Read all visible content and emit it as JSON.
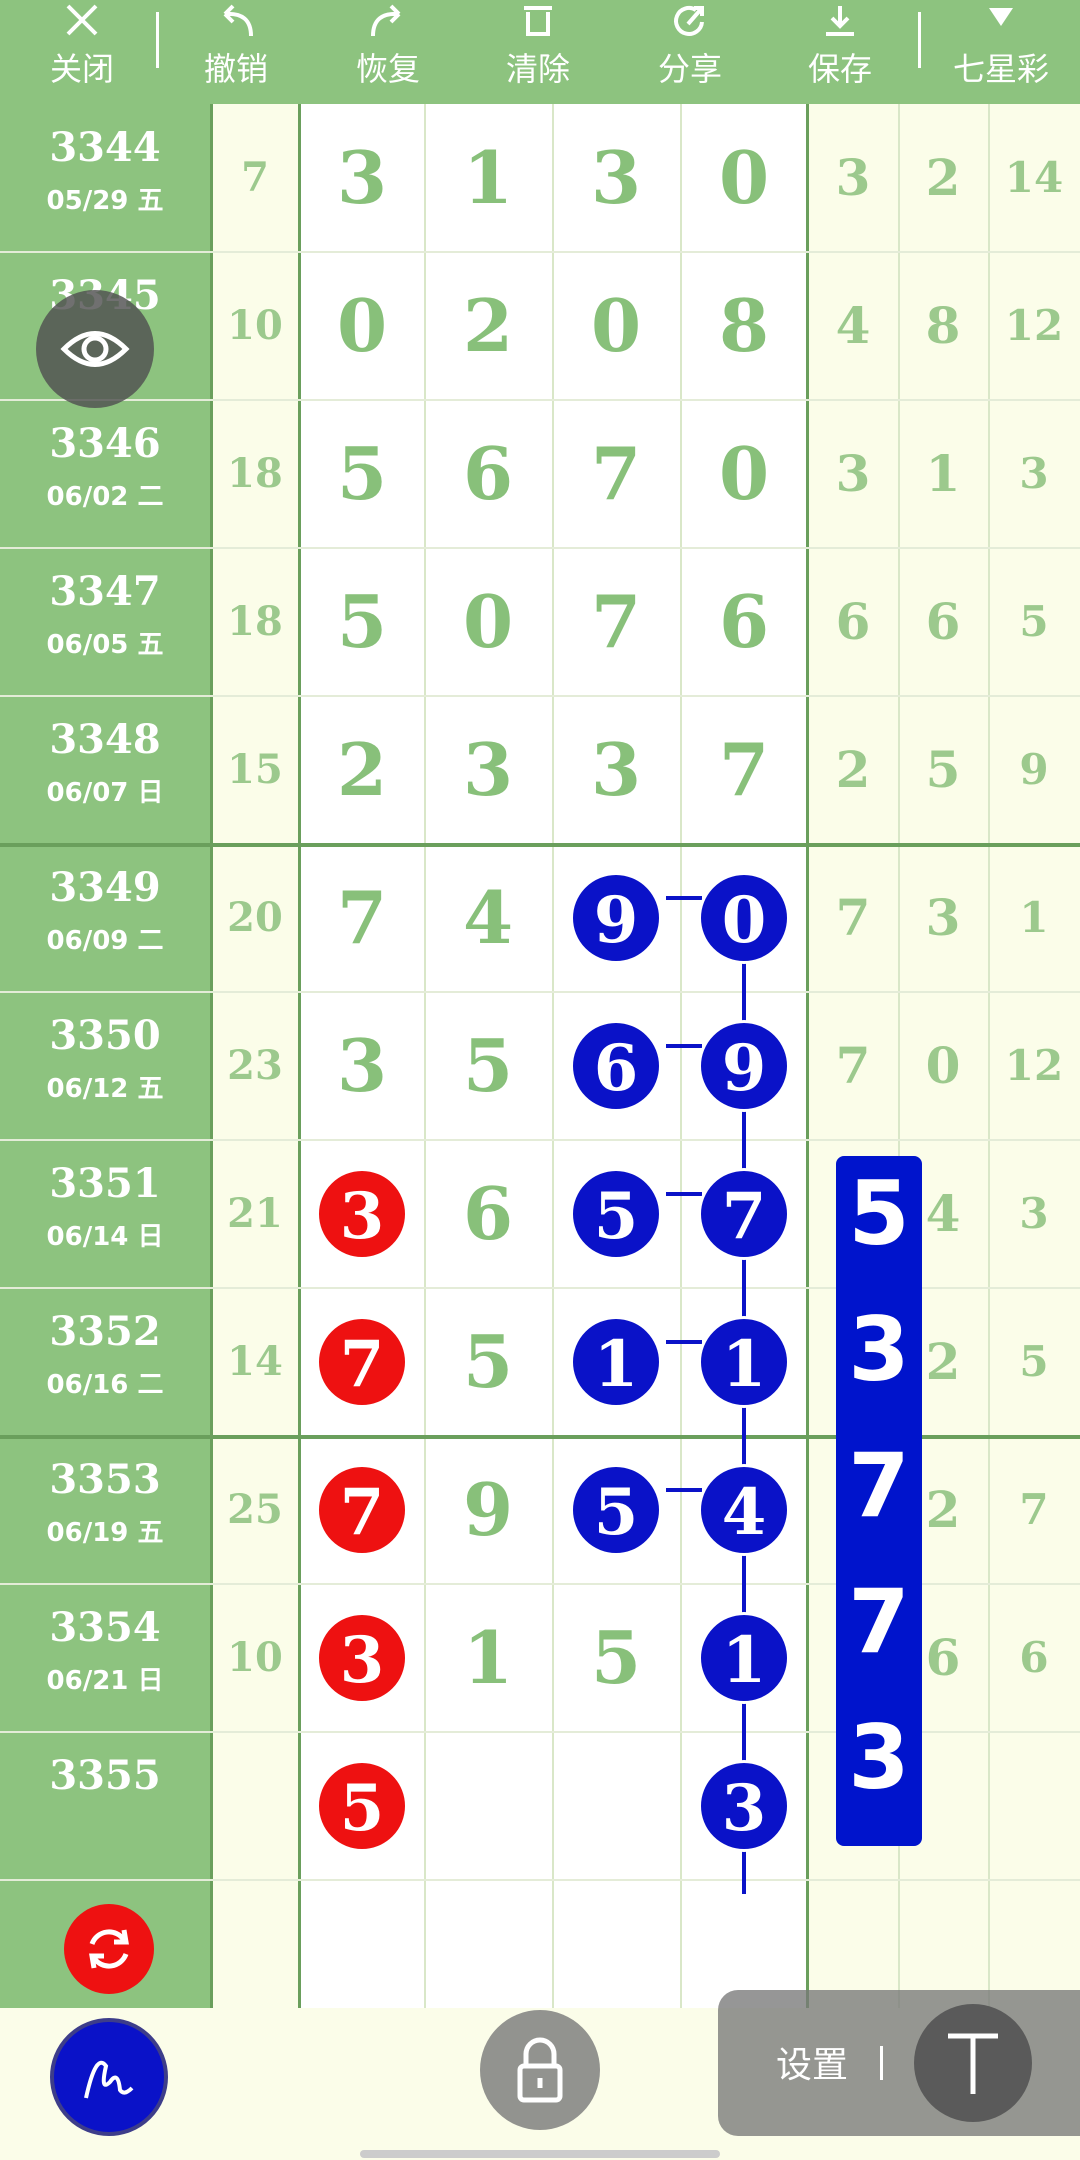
{
  "toolbar": {
    "items": [
      {
        "label": "关闭",
        "icon": "close-icon"
      },
      {
        "label": "撤销",
        "icon": "undo-icon"
      },
      {
        "label": "恢复",
        "icon": "redo-icon"
      },
      {
        "label": "清除",
        "icon": "trash-icon"
      },
      {
        "label": "分享",
        "icon": "share-icon"
      },
      {
        "label": "保存",
        "icon": "download-icon"
      },
      {
        "label": "七星彩",
        "icon": "caret-down-icon"
      }
    ]
  },
  "rows": [
    {
      "issue": "3344",
      "date": "05/29 五",
      "sum": "7",
      "digits": [
        "3",
        "1",
        "3",
        "0"
      ],
      "tail": [
        "3",
        "2",
        "14"
      ]
    },
    {
      "issue": "3345",
      "date": "",
      "sum": "10",
      "digits": [
        "0",
        "2",
        "0",
        "8"
      ],
      "tail": [
        "4",
        "8",
        "12"
      ]
    },
    {
      "issue": "3346",
      "date": "06/02 二",
      "sum": "18",
      "digits": [
        "5",
        "6",
        "7",
        "0"
      ],
      "tail": [
        "3",
        "1",
        "3"
      ]
    },
    {
      "issue": "3347",
      "date": "06/05 五",
      "sum": "18",
      "digits": [
        "5",
        "0",
        "7",
        "6"
      ],
      "tail": [
        "6",
        "6",
        "5"
      ]
    },
    {
      "issue": "3348",
      "date": "06/07 日",
      "sum": "15",
      "digits": [
        "2",
        "3",
        "3",
        "7"
      ],
      "tail": [
        "2",
        "5",
        "9"
      ]
    },
    {
      "issue": "3349",
      "date": "06/09 二",
      "sum": "20",
      "digits": [
        "7",
        "4",
        "9",
        "0"
      ],
      "tail": [
        "7",
        "3",
        "1"
      ]
    },
    {
      "issue": "3350",
      "date": "06/12 五",
      "sum": "23",
      "digits": [
        "3",
        "5",
        "6",
        "9"
      ],
      "tail": [
        "7",
        "0",
        "12"
      ]
    },
    {
      "issue": "3351",
      "date": "06/14 日",
      "sum": "21",
      "digits": [
        "3",
        "6",
        "5",
        "7"
      ],
      "tail": [
        "",
        "4",
        "3"
      ]
    },
    {
      "issue": "3352",
      "date": "06/16 二",
      "sum": "14",
      "digits": [
        "7",
        "5",
        "1",
        "1"
      ],
      "tail": [
        "",
        "2",
        "5"
      ]
    },
    {
      "issue": "3353",
      "date": "06/19 五",
      "sum": "25",
      "digits": [
        "7",
        "9",
        "5",
        "4"
      ],
      "tail": [
        "",
        "2",
        "7"
      ]
    },
    {
      "issue": "3354",
      "date": "06/21 日",
      "sum": "10",
      "digits": [
        "3",
        "1",
        "5",
        "1"
      ],
      "tail": [
        "",
        "6",
        "6"
      ]
    },
    {
      "issue": "3355",
      "date": "",
      "sum": "",
      "digits": [
        "5",
        "",
        "",
        "3"
      ],
      "tail": [
        "",
        "",
        ""
      ]
    }
  ],
  "marks": {
    "red": [
      [
        7,
        0
      ],
      [
        8,
        0
      ],
      [
        9,
        0
      ],
      [
        10,
        0
      ],
      [
        11,
        0
      ]
    ],
    "blue": [
      [
        5,
        2
      ],
      [
        5,
        3
      ],
      [
        6,
        2
      ],
      [
        6,
        3
      ],
      [
        7,
        2
      ],
      [
        7,
        3
      ],
      [
        8,
        2
      ],
      [
        8,
        3
      ],
      [
        9,
        2
      ],
      [
        9,
        3
      ],
      [
        10,
        3
      ],
      [
        11,
        3
      ]
    ]
  },
  "vertical_bar": [
    "5",
    "3",
    "7",
    "7",
    "3"
  ],
  "settings": {
    "label": "设置",
    "text_tool": "T"
  },
  "colors": {
    "toolbar": "#8dc37f",
    "issue_col": "#8dc37f",
    "red": "#ee1111",
    "blue": "#0a12c8"
  }
}
